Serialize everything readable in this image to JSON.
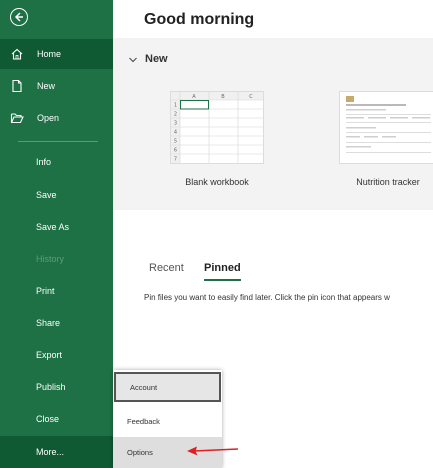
{
  "sidebar": {
    "items": [
      {
        "label": "Home"
      },
      {
        "label": "New"
      },
      {
        "label": "Open"
      },
      {
        "label": "Info"
      },
      {
        "label": "Save"
      },
      {
        "label": "Save As"
      },
      {
        "label": "History"
      },
      {
        "label": "Print"
      },
      {
        "label": "Share"
      },
      {
        "label": "Export"
      },
      {
        "label": "Publish"
      },
      {
        "label": "Close"
      },
      {
        "label": "More..."
      }
    ]
  },
  "main": {
    "greeting": "Good morning",
    "new_section": {
      "title": "New",
      "templates": [
        {
          "label": "Blank workbook"
        },
        {
          "label": "Nutrition tracker"
        }
      ]
    },
    "tabs": [
      {
        "label": "Recent"
      },
      {
        "label": "Pinned"
      }
    ],
    "pinned_info": "Pin files you want to easily find later. Click the pin icon that appears w"
  },
  "more_menu": {
    "items": [
      {
        "label": "Account"
      },
      {
        "label": "Feedback"
      },
      {
        "label": "Options"
      }
    ]
  },
  "grid": {
    "columns": [
      "A",
      "B",
      "C"
    ],
    "rows": [
      "1",
      "2",
      "3",
      "4",
      "5",
      "6",
      "7"
    ]
  },
  "colors": {
    "sidebar_bg": "#1e7145",
    "sidebar_active": "#0f5a33",
    "arrow": "#e02020"
  }
}
